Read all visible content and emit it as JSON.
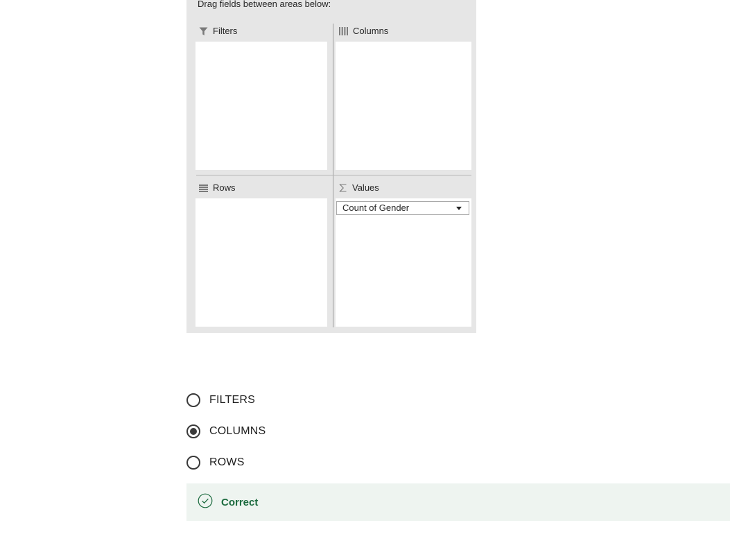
{
  "pivot_panel": {
    "instruction": "Drag fields between areas below:",
    "areas": {
      "filters": {
        "label": "Filters",
        "icon": "filter-icon"
      },
      "columns": {
        "label": "Columns",
        "icon": "columns-icon"
      },
      "rows": {
        "label": "Rows",
        "icon": "rows-icon"
      },
      "values": {
        "label": "Values",
        "icon": "sigma-icon",
        "items": [
          "Count of Gender"
        ]
      }
    }
  },
  "quiz": {
    "options": [
      {
        "label": "FILTERS",
        "selected": false
      },
      {
        "label": "COLUMNS",
        "selected": true
      },
      {
        "label": "ROWS",
        "selected": false
      }
    ],
    "feedback": {
      "label": "Correct",
      "icon": "check-circle-icon",
      "color": "#1c6b3f"
    }
  }
}
